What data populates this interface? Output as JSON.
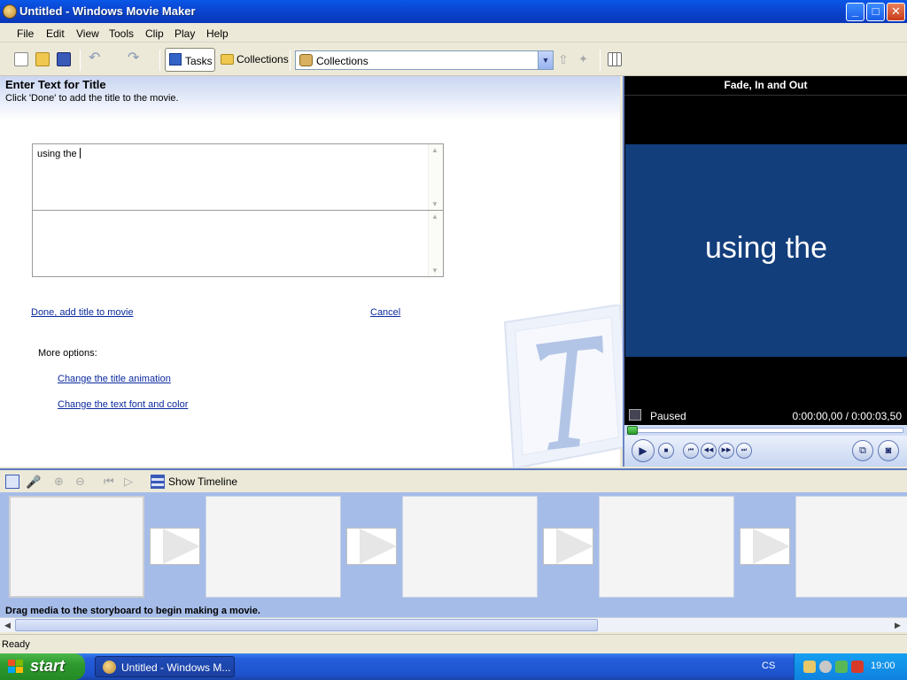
{
  "window": {
    "title": "Untitled - Windows Movie Maker",
    "controls": {
      "minimize": "_",
      "maximize": "□",
      "close": "✕"
    }
  },
  "menu": [
    "File",
    "Edit",
    "View",
    "Tools",
    "Clip",
    "Play",
    "Help"
  ],
  "toolbar": {
    "tasks_label": "Tasks",
    "collections_label": "Collections",
    "collections_select_value": "Collections",
    "icons": [
      "new-project-icon",
      "open-project-icon",
      "save-project-icon",
      "undo-icon",
      "redo-icon",
      "up-one-level-icon",
      "new-collection-folder-icon",
      "views-icon"
    ]
  },
  "task_pane": {
    "title": "Enter Text for Title",
    "instructions": "Click 'Done' to add the title to the movie.",
    "text_line1": "using the",
    "text_line2": "",
    "done_link": "Done, add title to movie",
    "cancel_link": "Cancel",
    "more_options_label": "More options:",
    "change_animation_link": "Change the title animation",
    "change_font_link": "Change the text font and color"
  },
  "monitor": {
    "clip_name": "Fade, In and Out",
    "preview_text": "using the",
    "status": "Paused",
    "time": "0:00:00,00 / 0:00:03,50",
    "progress": 0,
    "colors": {
      "preview_background": "#123e7c",
      "preview_text": "#ffffff"
    }
  },
  "storyboard": {
    "show_timeline_label": "Show Timeline",
    "hint": "Drag media to the storyboard to begin making a movie.",
    "clip_slots": 5,
    "transition_slots": 4
  },
  "status_bar": {
    "text": "Ready"
  },
  "taskbar": {
    "start_label": "start",
    "task_button_label": "Untitled - Windows M...",
    "language": "CS",
    "clock": "19:00"
  }
}
